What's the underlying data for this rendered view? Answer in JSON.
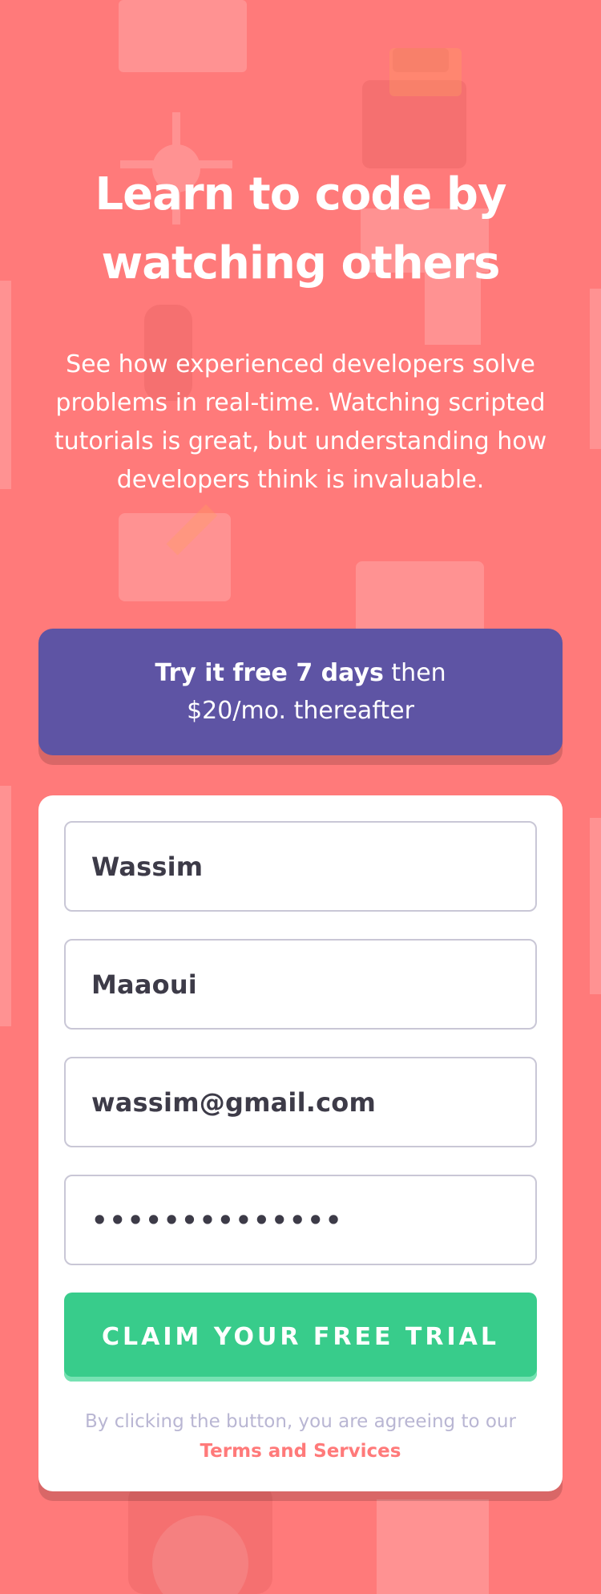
{
  "hero": {
    "title_line1": "Learn to code by",
    "title_line2": "watching others",
    "description": "See how experienced developers solve problems in real-time. Watching scripted tutorials is great, but understanding how developers think is invaluable."
  },
  "offer": {
    "strong": "Try it free 7 days",
    "rest": "then $20/mo. thereafter"
  },
  "form": {
    "first_name": "Wassim",
    "last_name": "Maaoui",
    "email": "wassim@gmail.com",
    "password_masked": "••••••••••••••",
    "submit_label": "CLAIM YOUR FREE TRIAL",
    "terms_text": "By clicking the button, you are agreeing to our",
    "terms_link": "Terms and Services"
  },
  "colors": {
    "background": "#ff7a7a",
    "offer_bg": "#5e54a4",
    "button_bg": "#38cc8b",
    "link": "#ff7a7a"
  }
}
